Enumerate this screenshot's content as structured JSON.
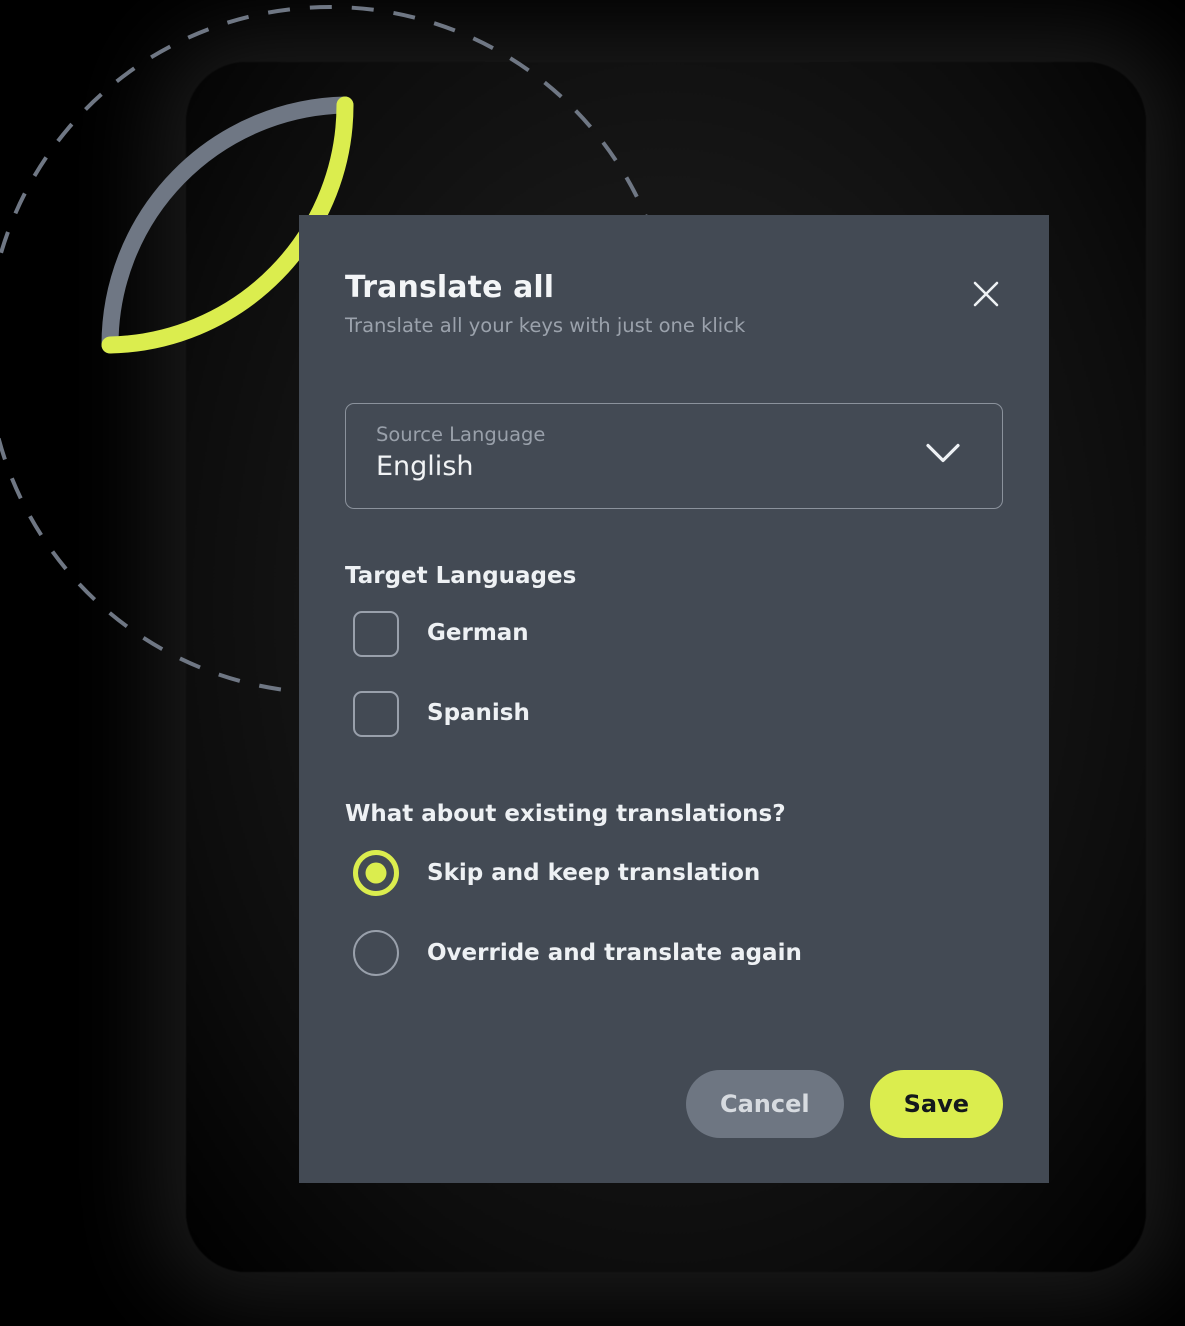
{
  "theme": {
    "page_background": "#000000",
    "modal_background": "#434a54",
    "accent_lime": "#dbed4e",
    "muted_text": "#99a0aa",
    "primary_text": "#eef1f4",
    "outline_gray": "#8b929c",
    "cancel_background": "#6e7682"
  },
  "decoration": {
    "solid_ring": {
      "name": "progress-ring",
      "gray_color": "#6f7784",
      "lime_color": "#dbed4e"
    },
    "dashed_ring": {
      "name": "dashed-circle",
      "color": "#6f7784"
    }
  },
  "modal": {
    "title": "Translate all",
    "subtitle": "Translate all your keys with just one klick",
    "close_icon": "close-icon",
    "source_language": {
      "label": "Source Language",
      "value": "English",
      "chevron_icon": "chevron-down-icon"
    },
    "target_languages": {
      "title": "Target Languages",
      "options": [
        {
          "label": "German",
          "checked": false
        },
        {
          "label": "Spanish",
          "checked": false
        }
      ]
    },
    "existing_translations": {
      "title": "What about existing translations?",
      "options": [
        {
          "label": "Skip and keep translation",
          "checked": true
        },
        {
          "label": "Override and translate again",
          "checked": false
        }
      ]
    },
    "footer": {
      "cancel_label": "Cancel",
      "save_label": "Save"
    }
  }
}
